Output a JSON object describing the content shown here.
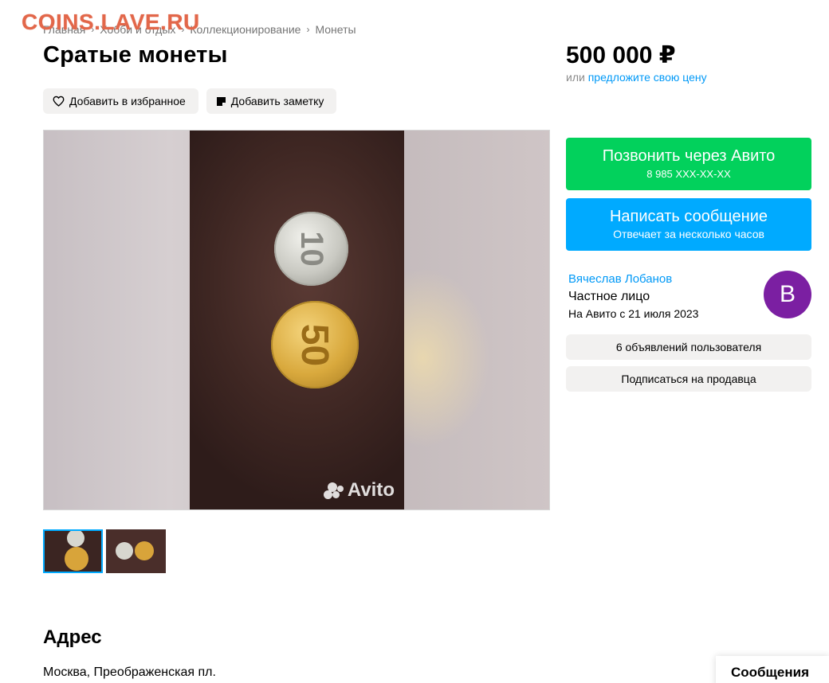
{
  "watermark": "COINS.LAVE.RU",
  "breadcrumb": [
    "Главная",
    "Хобби и отдых",
    "Коллекционирование",
    "Монеты"
  ],
  "title": "Сратые монеты",
  "actions": {
    "favorite": "Добавить в избранное",
    "note": "Добавить заметку"
  },
  "gallery": {
    "watermark": "Avito",
    "coin_top": "10",
    "coin_bottom": "50",
    "thumbnail_count": 2
  },
  "price": {
    "value": "500 000 ₽",
    "prefix": "или",
    "offer_link": "предложите свою цену"
  },
  "call_button": {
    "label": "Позвонить через Авито",
    "phone": "8 985 XXX-XX-XX"
  },
  "message_button": {
    "label": "Написать сообщение",
    "sublabel": "Отвечает за несколько часов"
  },
  "seller": {
    "name": "Вячеслав Лобанов",
    "type": "Частное лицо",
    "since": "На Авито с 21 июля 2023",
    "avatar_letter": "B",
    "avatar_color": "#7b1fa2"
  },
  "seller_buttons": {
    "ads": "6 объявлений пользователя",
    "subscribe": "Подписаться на продавца"
  },
  "address": {
    "heading": "Адрес",
    "value": "Москва, Преображенская пл."
  },
  "messages_tab": "Сообщения",
  "colors": {
    "call": "#02d15c",
    "message": "#00aaff",
    "link": "#0099f7",
    "watermark": "#e2674a"
  }
}
